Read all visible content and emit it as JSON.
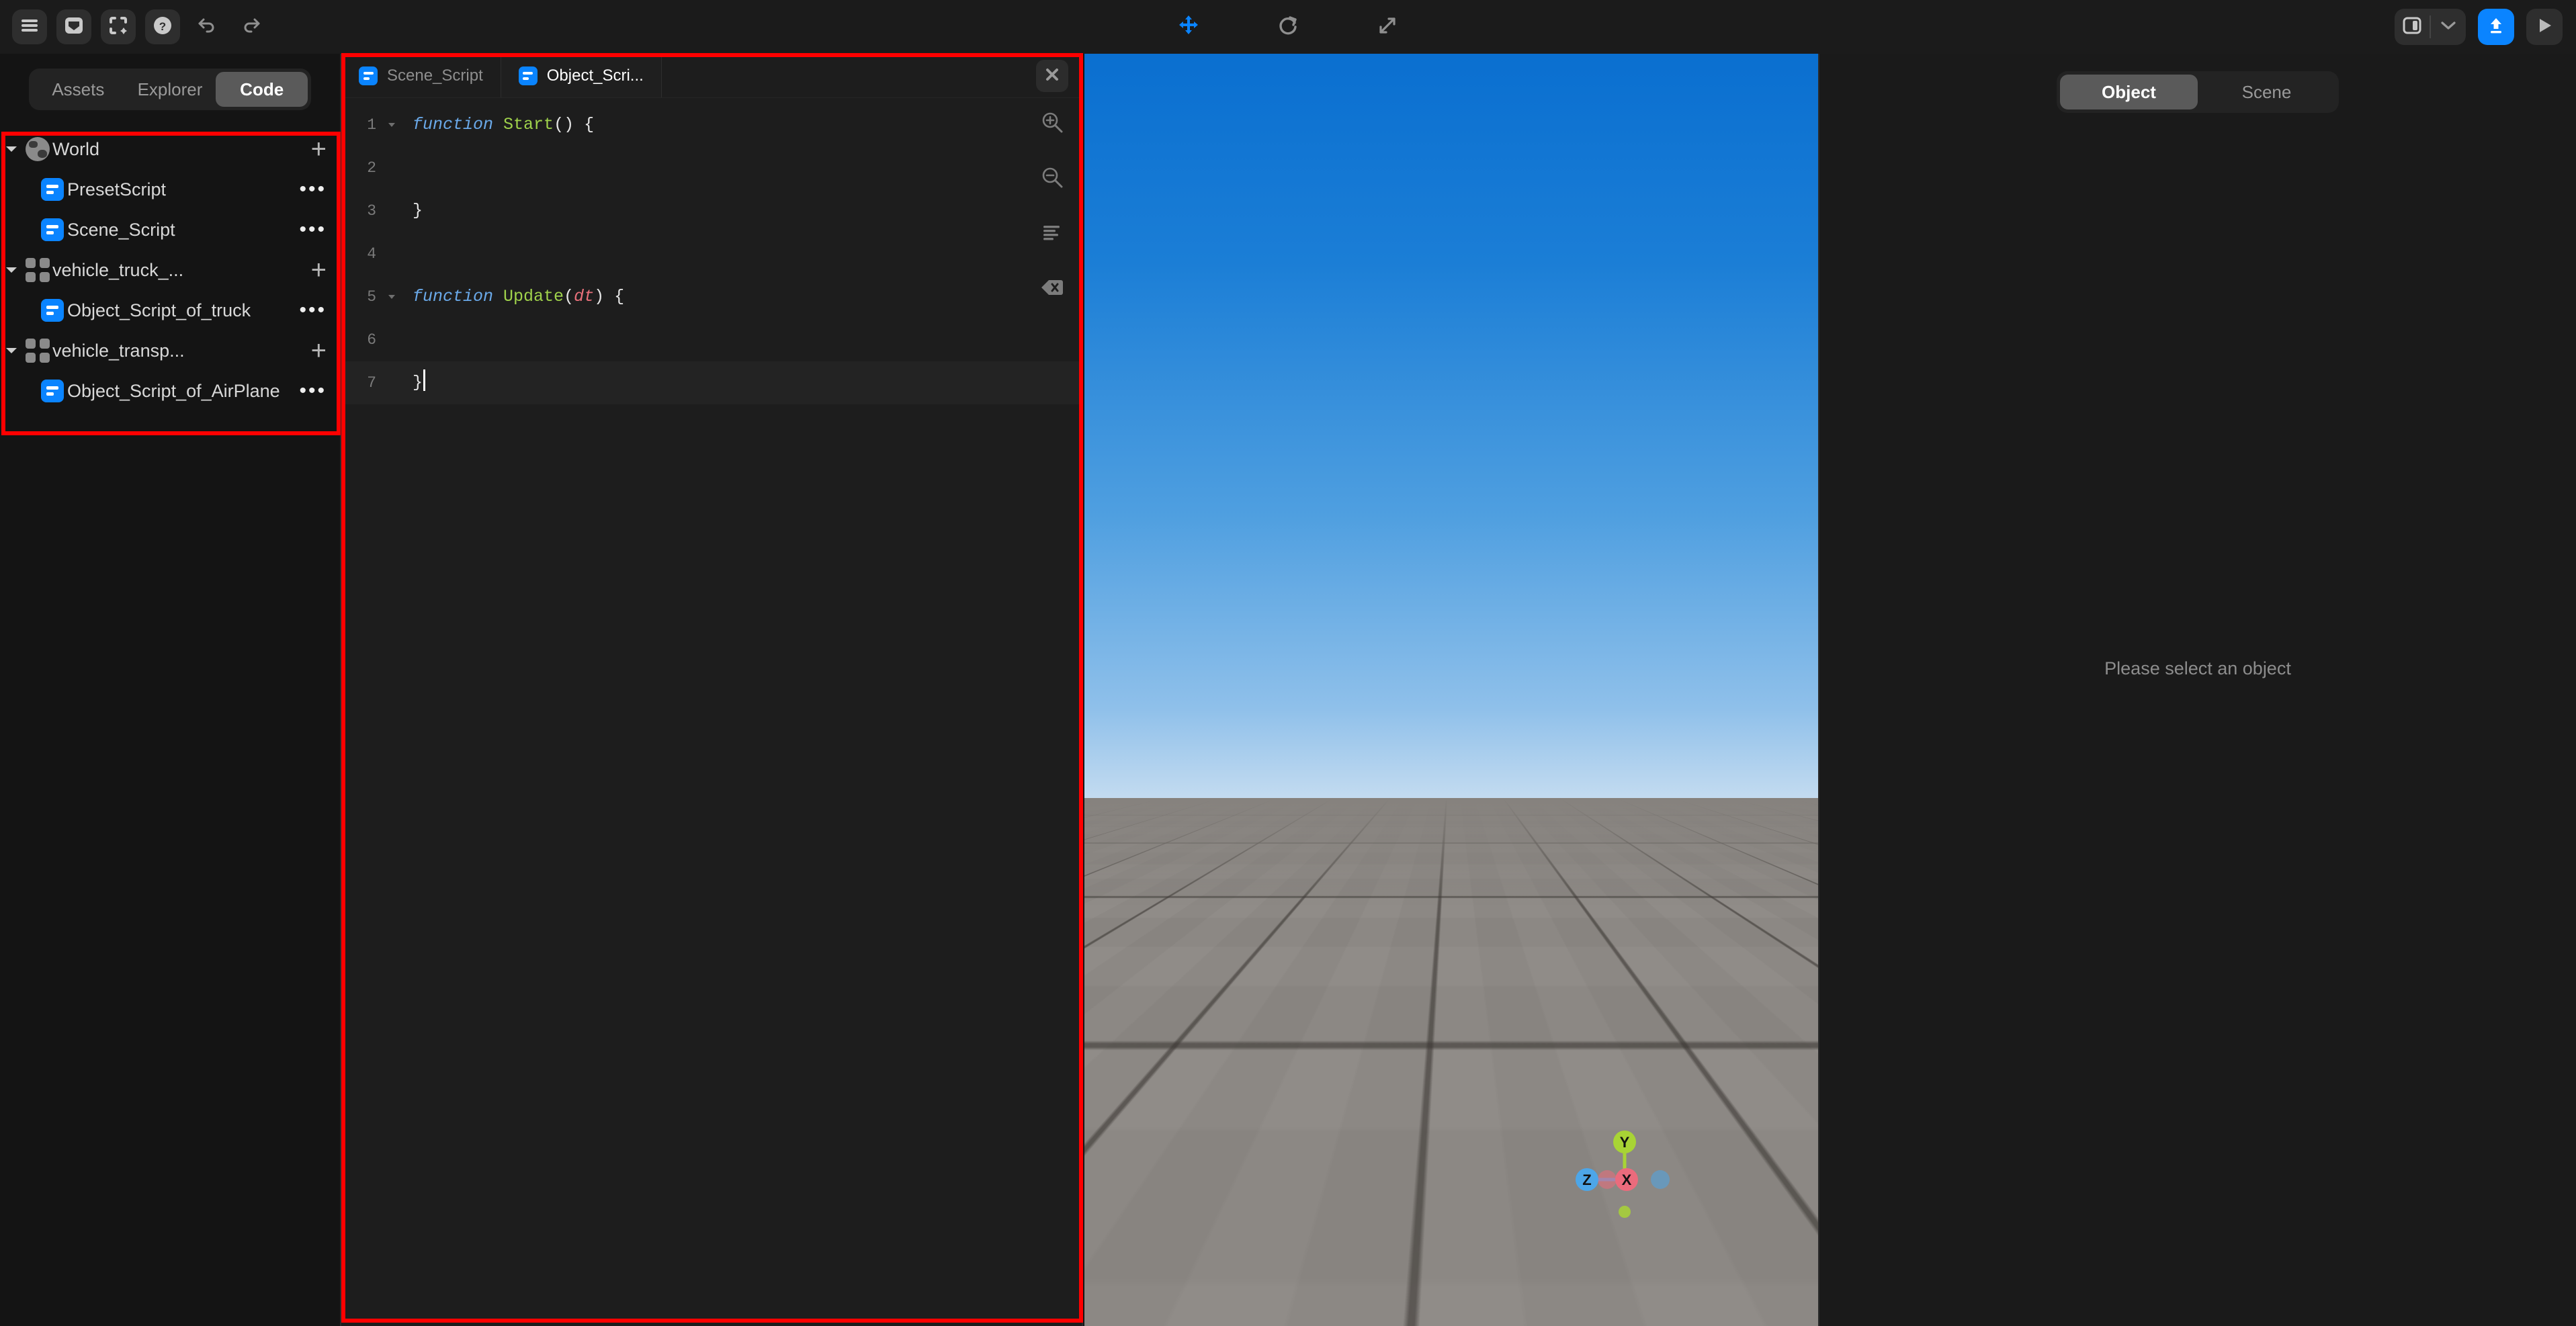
{
  "topbar": {
    "left_buttons": [
      {
        "name": "menu-icon",
        "label": "Menu"
      },
      {
        "name": "panel-icon",
        "label": "Panel"
      },
      {
        "name": "fullscreen-icon",
        "label": "Fullscreen"
      },
      {
        "name": "help-icon",
        "label": "Help"
      }
    ],
    "undo_label": "Undo",
    "redo_label": "Redo",
    "transform_tools": [
      {
        "name": "move-tool",
        "label": "Move",
        "active": true
      },
      {
        "name": "rotate-tool",
        "label": "Rotate",
        "active": false
      },
      {
        "name": "scale-tool",
        "label": "Scale",
        "active": false
      }
    ],
    "layout_toggle_label": "Layout",
    "layout_chevron_label": "Layout options",
    "publish_label": "Publish",
    "play_label": "Play"
  },
  "sidebar": {
    "tabs": [
      {
        "label": "Assets",
        "active": false
      },
      {
        "label": "Explorer",
        "active": false
      },
      {
        "label": "Code",
        "active": true
      }
    ],
    "tree": [
      {
        "label": "World",
        "icon": "globe-icon",
        "depth": 0,
        "expanded": true,
        "action": "plus"
      },
      {
        "label": "PresetScript",
        "icon": "script-icon",
        "depth": 1,
        "expanded": null,
        "action": "dots"
      },
      {
        "label": "Scene_Script",
        "icon": "script-icon",
        "depth": 1,
        "expanded": null,
        "action": "dots"
      },
      {
        "label": "vehicle_truck_...",
        "icon": "group-icon",
        "depth": 0,
        "expanded": true,
        "action": "plus"
      },
      {
        "label": "Object_Script_of_truck",
        "icon": "script-icon",
        "depth": 1,
        "expanded": null,
        "action": "dots"
      },
      {
        "label": "vehicle_transp...",
        "icon": "group-icon",
        "depth": 0,
        "expanded": true,
        "action": "plus"
      },
      {
        "label": "Object_Script_of_AirPlane",
        "icon": "script-icon",
        "depth": 1,
        "expanded": null,
        "action": "dots"
      }
    ],
    "plus_glyph": "+",
    "dots_glyph": "•••"
  },
  "editor": {
    "tabs": [
      {
        "label": "Scene_Script",
        "active": false
      },
      {
        "label": "Object_Scri...",
        "active": true
      }
    ],
    "close_label": "Close",
    "lines": [
      {
        "num": "1",
        "foldable": true,
        "segments": [
          {
            "t": "function",
            "c": "k-fn"
          },
          {
            "t": " ",
            "c": "k-punc"
          },
          {
            "t": "Start",
            "c": "k-name"
          },
          {
            "t": "() {",
            "c": "k-punc"
          }
        ]
      },
      {
        "num": "2",
        "foldable": false,
        "segments": []
      },
      {
        "num": "3",
        "foldable": false,
        "segments": [
          {
            "t": "}",
            "c": "k-punc"
          }
        ]
      },
      {
        "num": "4",
        "foldable": false,
        "segments": []
      },
      {
        "num": "5",
        "foldable": true,
        "segments": [
          {
            "t": "function",
            "c": "k-fn"
          },
          {
            "t": " ",
            "c": "k-punc"
          },
          {
            "t": "Update",
            "c": "k-name"
          },
          {
            "t": "(",
            "c": "k-punc"
          },
          {
            "t": "dt",
            "c": "k-param"
          },
          {
            "t": ") {",
            "c": "k-punc"
          }
        ]
      },
      {
        "num": "6",
        "foldable": false,
        "segments": []
      },
      {
        "num": "7",
        "foldable": false,
        "active": true,
        "segments": [
          {
            "t": "}",
            "c": "k-punc"
          }
        ]
      }
    ],
    "tools": [
      {
        "name": "zoom-in-icon",
        "label": "Zoom in"
      },
      {
        "name": "zoom-out-icon",
        "label": "Zoom out"
      },
      {
        "name": "format-code-icon",
        "label": "Format"
      },
      {
        "name": "clear-icon",
        "label": "Clear"
      }
    ]
  },
  "viewport": {
    "gizmo_axes": [
      {
        "label": "Y",
        "color": "#a8d435"
      },
      {
        "label": "Z",
        "color": "#4da6e8"
      },
      {
        "label": "X",
        "color": "#eb6b7c"
      }
    ],
    "sky_top_color": "#0a6fd0",
    "sky_horizon_color": "#c3dbf0",
    "ground_color": "#888480"
  },
  "inspector": {
    "tabs": [
      {
        "label": "Object",
        "active": true
      },
      {
        "label": "Scene",
        "active": false
      }
    ],
    "empty_message": "Please select an object"
  },
  "annotations": {
    "sidebar_highlight_color": "#ff0000",
    "editor_highlight_color": "#ff0000"
  }
}
